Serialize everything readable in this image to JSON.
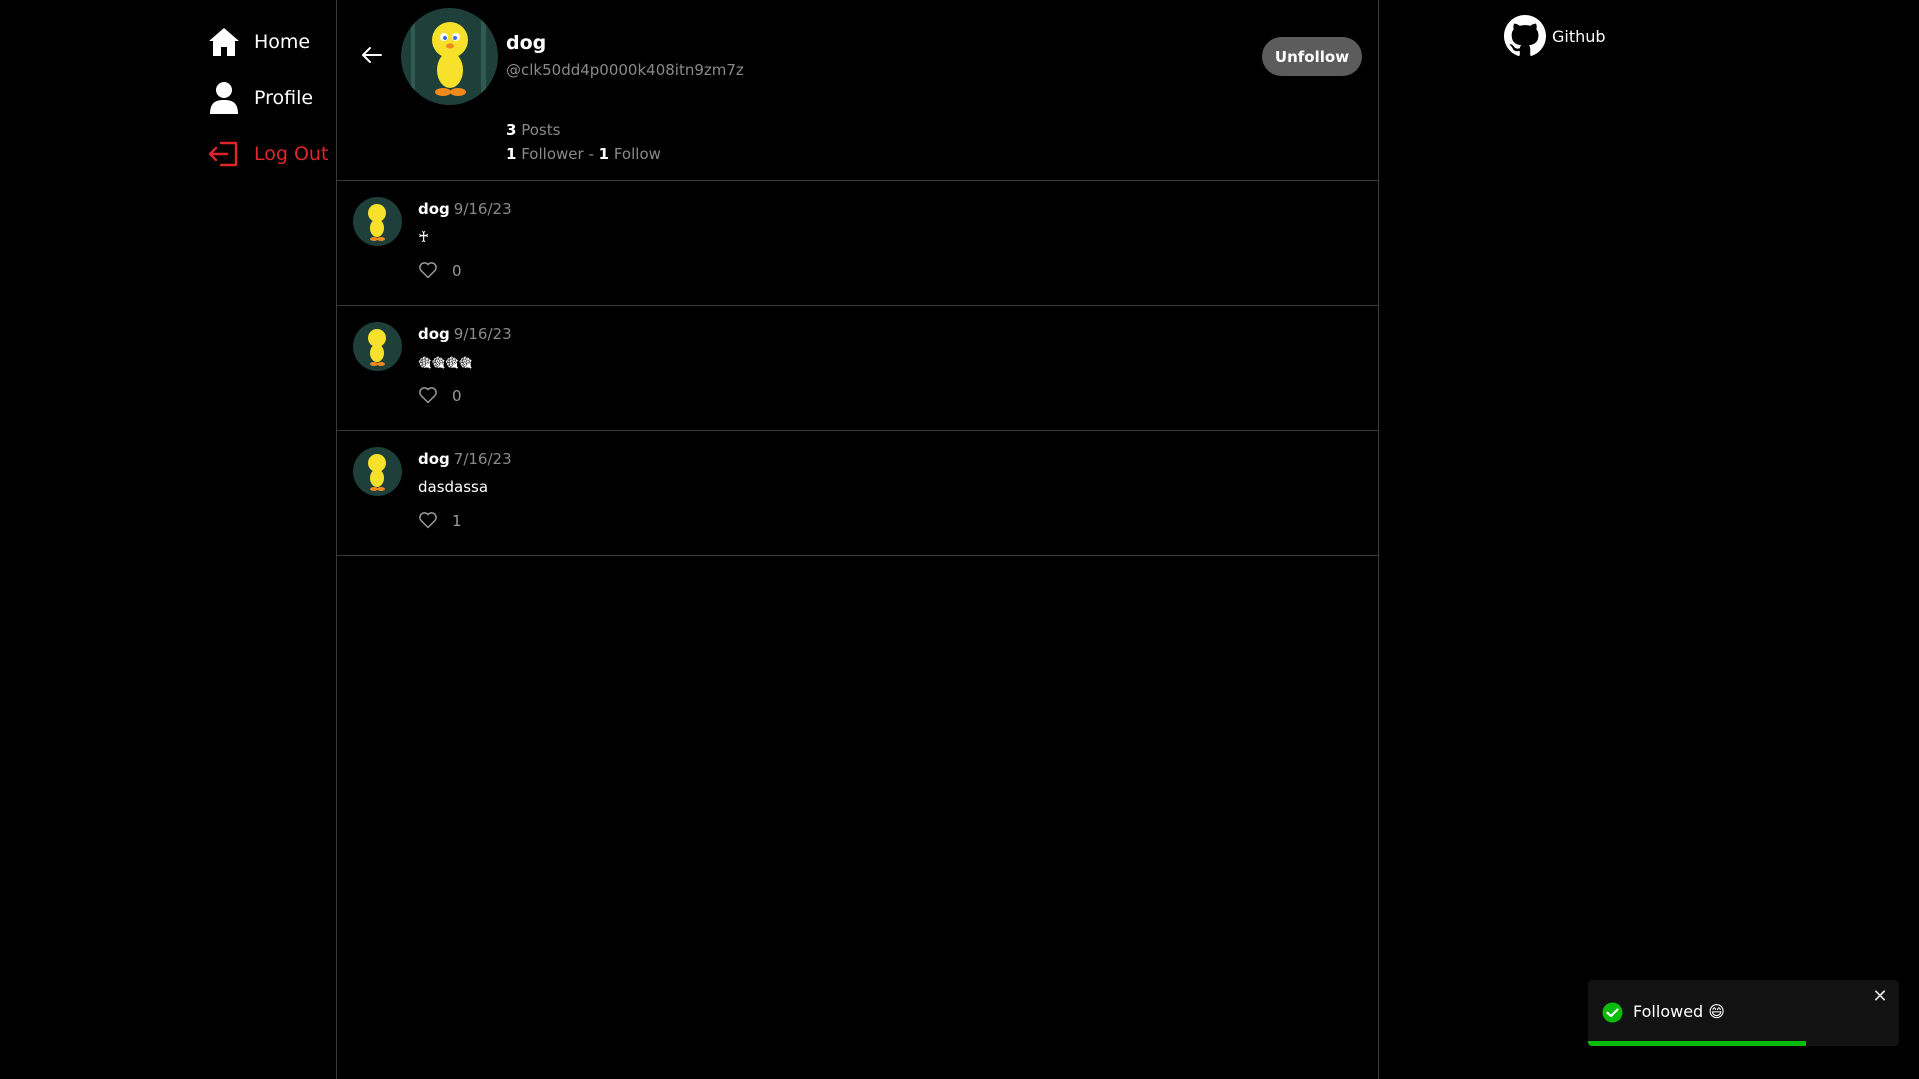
{
  "nav": {
    "items": [
      {
        "label": "Home",
        "icon": "home-icon"
      },
      {
        "label": "Profile",
        "icon": "user-icon"
      },
      {
        "label": "Log Out",
        "icon": "logout-icon"
      }
    ]
  },
  "profile": {
    "name": "dog",
    "handle": "@clk50dd4p0000k408itn9zm7z",
    "posts_count": "3",
    "posts_label": "Posts",
    "followers_count": "1",
    "followers_label": "Follower",
    "separator": " - ",
    "follows_count": "1",
    "follows_label": "Follow",
    "unfollow_label": "Unfollow"
  },
  "posts": [
    {
      "author": "dog",
      "date": "9/16/23",
      "body": "♰",
      "likes": "0"
    },
    {
      "author": "dog",
      "date": "9/16/23",
      "body": "🎕🎕🎕🎕",
      "likes": "0"
    },
    {
      "author": "dog",
      "date": "7/16/23",
      "body": "dasdassa",
      "likes": "1"
    }
  ],
  "github": {
    "label": "Github",
    "icon": "github-icon"
  },
  "toast": {
    "message": "Followed 😄",
    "progress": 0.7,
    "close": "✕",
    "icon": "check-circle-icon"
  },
  "colors": {
    "accent_logout": "#e0242b",
    "toast_progress": "#07bc0c",
    "unfollow_bg": "#5c5c5c"
  }
}
